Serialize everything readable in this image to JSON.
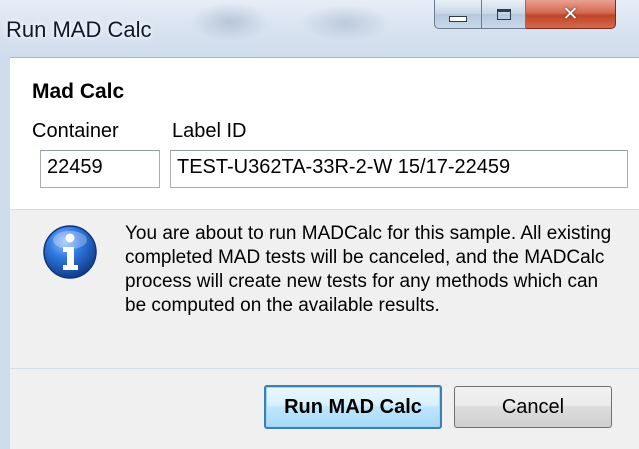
{
  "window": {
    "title": "Run MAD Calc",
    "controls": {
      "minimize_icon": "minimize-icon",
      "maximize_icon": "maximize-icon",
      "close_icon": "close-icon"
    }
  },
  "form": {
    "section_title": "Mad Calc",
    "container_label": "Container",
    "container_value": "22459",
    "label_id_label": "Label ID",
    "label_id_value": "TEST-U362TA-33R-2-W 15/17-22459"
  },
  "message": {
    "icon": "info-icon",
    "text": "You are about to run MADCalc for this sample.  All existing completed MAD tests will be canceled, and the MADCalc process will create new tests for any methods which can be computed on the available results."
  },
  "buttons": {
    "run_label": "Run MAD Calc",
    "cancel_label": "Cancel"
  },
  "colors": {
    "titlebar": "#d8e3f0",
    "close_button": "#c0452a",
    "panel_bg": "#f0f0f0",
    "info_icon": "#1f5fc7",
    "default_button_border": "#3c7fb1"
  }
}
